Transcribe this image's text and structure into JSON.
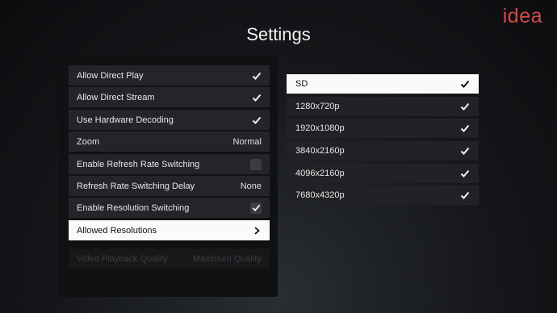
{
  "watermark": {
    "text": "idea",
    "color": "#d24a4a"
  },
  "title": "Settings",
  "settings": [
    {
      "label": "Allow Direct Play",
      "value": "",
      "control": "check"
    },
    {
      "label": "Allow Direct Stream",
      "value": "",
      "control": "check"
    },
    {
      "label": "Use Hardware Decoding",
      "value": "",
      "control": "check"
    },
    {
      "label": "Zoom",
      "value": "Normal",
      "control": "text"
    },
    {
      "label": "Enable Refresh Rate Switching",
      "value": "",
      "control": "box"
    },
    {
      "label": "Refresh Rate Switching Delay",
      "value": "None",
      "control": "text"
    },
    {
      "label": "Enable Resolution Switching",
      "value": "",
      "control": "checkbox"
    },
    {
      "label": "Allowed Resolutions",
      "value": "",
      "control": "chevron",
      "selected": true
    },
    {
      "label": "Video Playback Quality",
      "value": "Maximum Quality",
      "control": "text",
      "faded": true
    }
  ],
  "resolutions": [
    {
      "label": "SD",
      "checked": true,
      "selected": true
    },
    {
      "label": "1280x720p",
      "checked": true
    },
    {
      "label": "1920x1080p",
      "checked": true
    },
    {
      "label": "3840x2160p",
      "checked": true
    },
    {
      "label": "4096x2160p",
      "checked": true
    },
    {
      "label": "7680x4320p",
      "checked": true
    }
  ],
  "icons": {
    "check": "check-icon",
    "chevron": "chevron-right-icon"
  }
}
